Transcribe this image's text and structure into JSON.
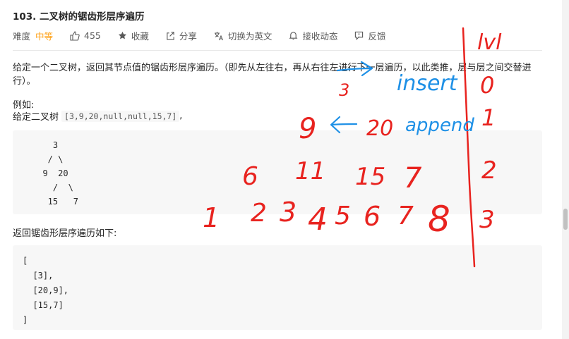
{
  "problem": {
    "title": "103. 二叉树的锯齿形层序遍历",
    "difficulty_label": "难度",
    "difficulty": "中等",
    "likes": "455",
    "favorite": "收藏",
    "share": "分享",
    "switch_lang": "切换为英文",
    "subscribe": "接收动态",
    "feedback": "反馈"
  },
  "description": {
    "text": "给定一个二叉树，返回其节点值的锯齿形层序遍历。（即先从左往右，再从右往左进行下一层遍历，以此类推，层与层之间交替进行）。",
    "example_label": "例如:",
    "given_label": "给定二叉树",
    "given_value": "[3,9,20,null,null,15,7]",
    "given_suffix": ",",
    "tree_ascii": "    3\n   / \\\n  9  20\n    /  \\\n   15   7",
    "return_label": "返回锯齿形层序遍历如下:",
    "result_ascii": "[\n  [3],\n  [20,9],\n  [15,7]\n]"
  },
  "annotations": {
    "color_red": "#e8231f",
    "color_blue": "#1e90e6",
    "lvl_header": "lvl",
    "levels": [
      "0",
      "1",
      "2",
      "3"
    ],
    "nums": [
      [
        "3"
      ],
      [
        "9",
        "20"
      ],
      [
        "6",
        "11",
        "15",
        "7"
      ],
      [
        "1",
        "2",
        "3",
        "4",
        "5",
        "6",
        "7",
        "8"
      ]
    ],
    "insert_label": "insert",
    "append_label": "append"
  }
}
